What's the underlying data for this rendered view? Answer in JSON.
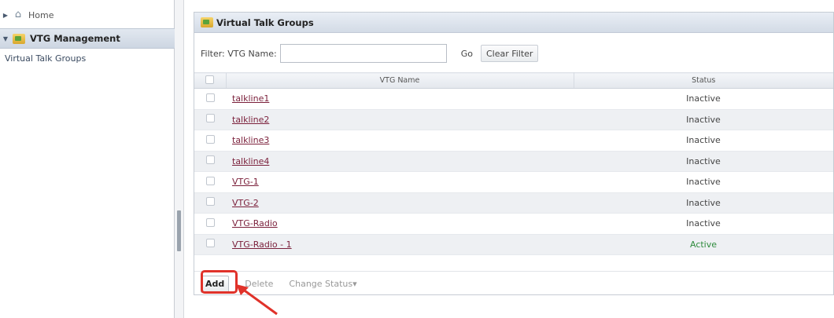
{
  "sidebar": {
    "home_label": "Home",
    "section_label": "VTG Management",
    "sub_item_label": "Virtual Talk Groups"
  },
  "panel": {
    "title": "Virtual Talk Groups",
    "filter_label": "Filter: VTG Name:",
    "filter_value": "",
    "go_label": "Go",
    "clear_label": "Clear Filter"
  },
  "table": {
    "columns": [
      "VTG Name",
      "Status"
    ],
    "rows": [
      {
        "name": "talkline1",
        "status": "Inactive"
      },
      {
        "name": "talkline2",
        "status": "Inactive"
      },
      {
        "name": "talkline3",
        "status": "Inactive"
      },
      {
        "name": "talkline4",
        "status": "Inactive"
      },
      {
        "name": "VTG-1",
        "status": "Inactive"
      },
      {
        "name": "VTG-2",
        "status": "Inactive"
      },
      {
        "name": "VTG-Radio",
        "status": "Inactive"
      },
      {
        "name": "VTG-Radio - 1",
        "status": "Active"
      }
    ]
  },
  "actions": {
    "add_label": "Add",
    "delete_label": "Delete",
    "change_status_label": "Change Status▾"
  },
  "colors": {
    "highlight": "#e0322a",
    "active_status": "#2e8b3c",
    "link": "#7a1f3a"
  }
}
